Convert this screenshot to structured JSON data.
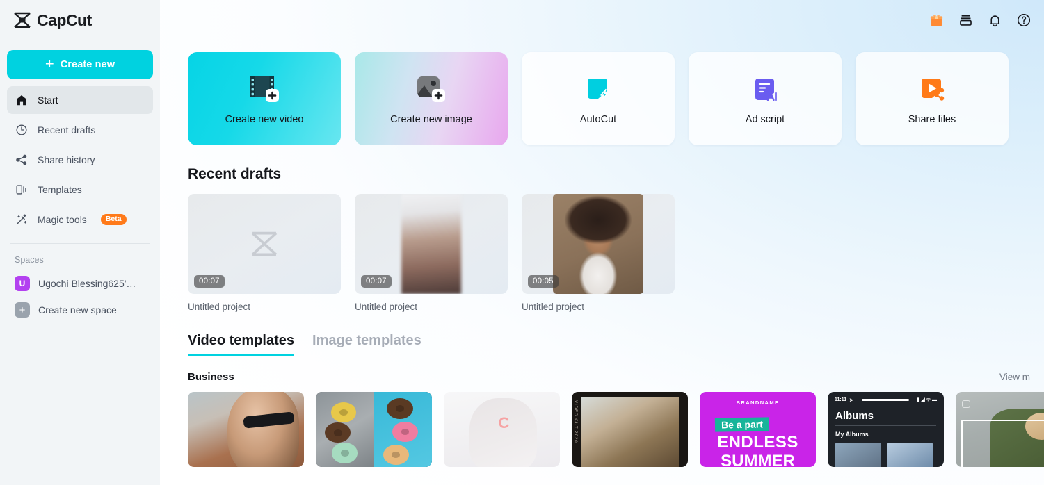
{
  "brand": {
    "name": "CapCut",
    "logo_icon": "capcut-logo-icon"
  },
  "sidebar": {
    "create_new_label": "Create new",
    "create_new_icon": "plus-icon",
    "nav": [
      {
        "label": "Start",
        "icon": "home-icon",
        "active": true
      },
      {
        "label": "Recent drafts",
        "icon": "clock-icon",
        "active": false
      },
      {
        "label": "Share history",
        "icon": "share-icon",
        "active": false
      },
      {
        "label": "Templates",
        "icon": "templates-icon",
        "active": false
      },
      {
        "label": "Magic tools",
        "icon": "magic-wand-icon",
        "badge": "Beta",
        "active": false
      }
    ],
    "spaces_label": "Spaces",
    "spaces": [
      {
        "label": "Ugochi Blessing625'…",
        "avatar_letter": "U",
        "avatar_color": "#b341f0",
        "icon": "space-avatar"
      },
      {
        "label": "Create new space",
        "avatar_letter": "+",
        "avatar_color": "#9aa3ad",
        "icon": "plus-icon"
      }
    ]
  },
  "topbar": {
    "icons": [
      {
        "name": "gift-icon",
        "glyph": "gift",
        "color": "#ff8a33"
      },
      {
        "name": "inbox-icon",
        "glyph": "inbox",
        "color": "#16181d"
      },
      {
        "name": "notification-bell-icon",
        "glyph": "bell",
        "color": "#16181d"
      },
      {
        "name": "help-icon",
        "glyph": "question-circle",
        "color": "#16181d"
      }
    ]
  },
  "actions": [
    {
      "label": "Create new video",
      "icon": "film-strip-add-icon",
      "style": "video"
    },
    {
      "label": "Create new image",
      "icon": "image-add-icon",
      "style": "image"
    },
    {
      "label": "AutoCut",
      "icon": "autocut-icon",
      "style": "plain"
    },
    {
      "label": "Ad script",
      "icon": "ad-script-ai-icon",
      "style": "plain"
    },
    {
      "label": "Share files",
      "icon": "share-files-icon",
      "style": "plain"
    }
  ],
  "recent_drafts": {
    "title": "Recent drafts",
    "items": [
      {
        "name": "Untitled project",
        "duration": "00:07",
        "thumb": "empty-capcut-placeholder"
      },
      {
        "name": "Untitled project",
        "duration": "00:07",
        "thumb": "blurred-couple-photo"
      },
      {
        "name": "Untitled project",
        "duration": "00:05",
        "thumb": "woman-curly-hair-photo"
      }
    ]
  },
  "templates": {
    "tabs": [
      {
        "label": "Video templates",
        "active": true
      },
      {
        "label": "Image templates",
        "active": false
      }
    ],
    "category": "Business",
    "view_more": "View m",
    "cards": [
      {
        "style": "t1",
        "alt": "woman-with-sunglasses"
      },
      {
        "style": "t2",
        "alt": "donuts-split-screen"
      },
      {
        "style": "t3",
        "alt": "faded-portrait-with-c-logo"
      },
      {
        "style": "t4",
        "alt": "blueberry-dessert-video-cut-2020",
        "vtext": "VIDEO CUT 2020"
      },
      {
        "style": "t5",
        "alt": "endless-summer-promo",
        "brand": "BRANDNAME",
        "tag": "Be a part",
        "line1": "ENDLESS",
        "line2": "SUMMER"
      },
      {
        "style": "t6",
        "alt": "albums-phone-ui",
        "time": "11:11",
        "title": "Albums",
        "subtitle": "My Albums"
      },
      {
        "style": "t7",
        "alt": "man-green-jacket"
      }
    ]
  }
}
